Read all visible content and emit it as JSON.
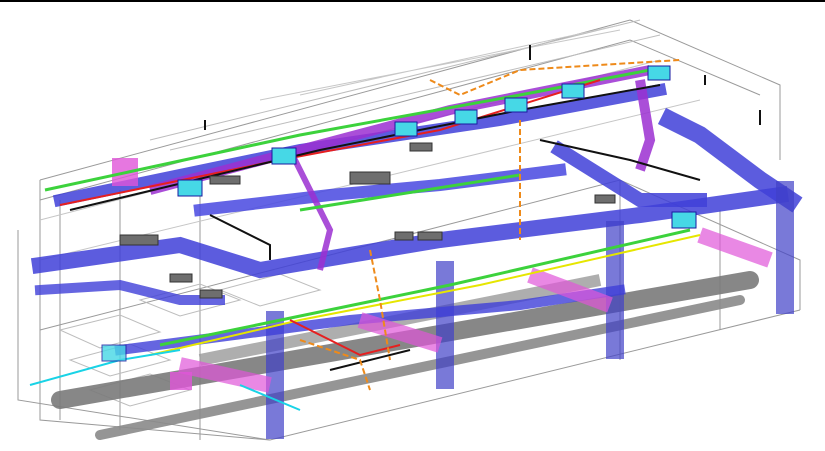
{
  "view": {
    "kind": "3D isometric MEP coordination model",
    "text_labels": []
  },
  "legend_colors": {
    "supply_duct": "#3f3fd8",
    "duct_outline": "#1a1aa0",
    "exhaust_duct": "#9b2fd1",
    "special_duct": "#e055d8",
    "equipment": "#46d8e6",
    "plumbing_pipe": "#7a7a7a",
    "sprinkler_main": "#e61f1f",
    "cable_tray_green": "#3cd23c",
    "yellow_line": "#e6e600",
    "orange_pipe": "#ee8a1a",
    "black_pipe": "#111111",
    "cyan_line": "#19d3e6",
    "structure_lines": "#9a9a9a"
  },
  "icons": {
    "vav_box": "cyan-box-icon",
    "air_handler": "magenta-box-icon",
    "diffuser": "grey-diffuser-icon"
  }
}
